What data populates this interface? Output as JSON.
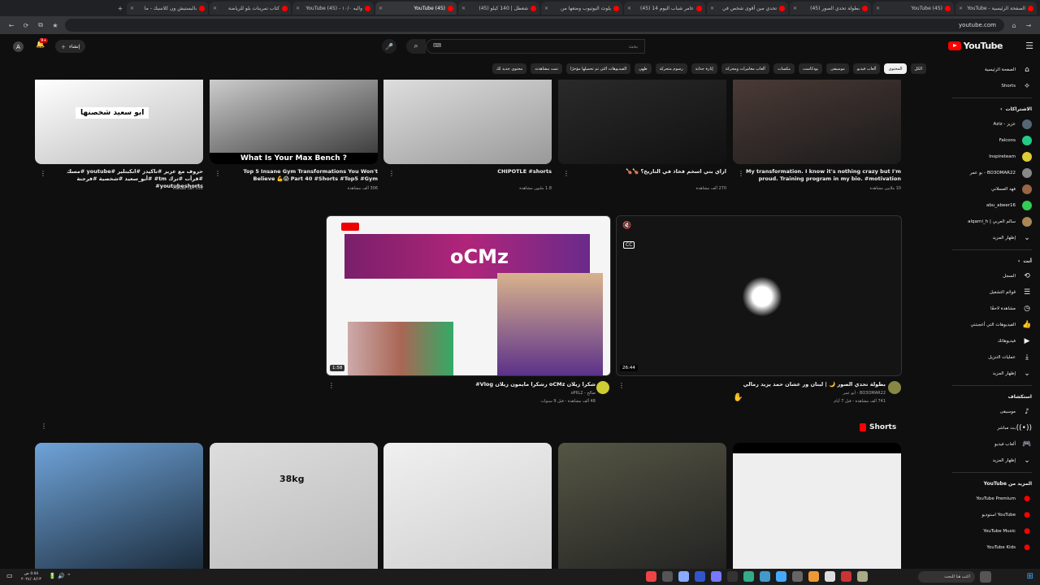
{
  "browser": {
    "tabs": [
      {
        "label": "الصفحة الرئيسية - YouTube",
        "active": false
      },
      {
        "label": "YouTube (45)",
        "active": false
      },
      {
        "label": "بطولة تحدي الصور (45)",
        "active": false
      },
      {
        "label": "تحدي مين أقوى شخص في",
        "active": false
      },
      {
        "label": "عامر شباب اليوم 14 (45)",
        "active": false
      },
      {
        "label": "يلوث اليوتيوب وضعها من",
        "active": false
      },
      {
        "label": "شعطل | 140 كيلو (45)",
        "active": false
      },
      {
        "label": "YouTube (45)",
        "active": true
      },
      {
        "label": "واليه ١٠/٠ - YouTube (45)",
        "active": false
      },
      {
        "label": "كتاب تمرينات بلو للرياضة",
        "active": false
      },
      {
        "label": "بالبستيش ون كلاسيك - ما",
        "active": false
      }
    ],
    "url": "youtube.com"
  },
  "header": {
    "logo": "YouTube",
    "logo_region": "SA",
    "search_placeholder": "بحث",
    "create_label": "إنشاء",
    "notif_count": "9+",
    "avatar_letter": "A"
  },
  "chips": [
    {
      "label": "الكل",
      "on": false
    },
    {
      "label": "المحتوى",
      "on": true
    },
    {
      "label": "ألعاب فيديو",
      "on": false
    },
    {
      "label": "موسيقى",
      "on": false
    },
    {
      "label": "بودكاست",
      "on": false
    },
    {
      "label": "مكسات",
      "on": false
    },
    {
      "label": "ألعاب مغامرات ومحركة",
      "on": false
    },
    {
      "label": "إثارة جذابة",
      "on": false
    },
    {
      "label": "رسوم متحركة",
      "on": false
    },
    {
      "label": "طهي",
      "on": false
    },
    {
      "label": "الفيديوهات التي تم تحميلها مؤخرًا",
      "on": false
    },
    {
      "label": "تمت مشاهدته",
      "on": false
    },
    {
      "label": "محتوى جديد لك",
      "on": false
    }
  ],
  "sidebar": {
    "main": [
      {
        "icon": "home-icon",
        "glyph": "⌂",
        "label": "الصفحة الرئيسية"
      },
      {
        "icon": "shorts-icon",
        "glyph": "⟡",
        "label": "Shorts"
      }
    ],
    "subs_title": "الاشتراكات",
    "subs": [
      {
        "label": "عزيز - Aziz",
        "color": "#567"
      },
      {
        "label": "Falcons",
        "color": "#2c8"
      },
      {
        "label": "Inspireteam",
        "color": "#dc3"
      },
      {
        "label": "BO3OMAR22 - بو عمر",
        "color": "#888"
      },
      {
        "label": "فهد العسلاني",
        "color": "#964"
      },
      {
        "label": "abu_abeer16",
        "color": "#3c5"
      },
      {
        "label": "سالم العربي | alqarni_h",
        "color": "#a85"
      }
    ],
    "subs_more": "إظهار المزيد",
    "you_title": "أنت",
    "you": [
      {
        "glyph": "⟲",
        "label": "السجل"
      },
      {
        "glyph": "☰",
        "label": "قوائم التشغيل"
      },
      {
        "glyph": "◷",
        "label": "مشاهدة لاحقًا"
      },
      {
        "glyph": "👍",
        "label": "الفيديوهات التي أعجبتني"
      },
      {
        "glyph": "▶",
        "label": "فيديوهاتك"
      },
      {
        "glyph": "⤓",
        "label": "عمليات التنزيل"
      }
    ],
    "you_more": "إظهار المزيد",
    "explore_title": "استكشاف",
    "explore": [
      {
        "glyph": "♪",
        "label": "موسيقى"
      },
      {
        "glyph": "((•))",
        "label": "بث مباشر"
      },
      {
        "glyph": "🎮",
        "label": "ألعاب فيديو"
      }
    ],
    "explore_more": "إظهار المزيد",
    "more_title": "المزيد من YouTube",
    "more": [
      {
        "label": "YouTube Premium"
      },
      {
        "label": "YouTube استوديو"
      },
      {
        "label": "YouTube Music"
      },
      {
        "label": "YouTube Kids"
      }
    ]
  },
  "top_shorts": [
    {
      "title": "My transformation. I know it's nothing crazy but I'm proud. Training program in my bio. #motivation",
      "meta": "10 ملايين مشاهدة",
      "thumb_text": ""
    },
    {
      "title": "ازاي بتي اسخم فخاذ في التاريخ؟ 🍗🍗",
      "meta": "270 ألف مشاهدة",
      "thumb_text": ""
    },
    {
      "title": "CHIPOTLE #shorts",
      "meta": "1.8 مليون مشاهدة",
      "thumb_text": ""
    },
    {
      "title": "Top 5 Insane Gym Transformations You Won't Believe 💪😱 Part 40 #Shorts #Top5 #Gym",
      "meta": "306 ألف مشاهدة",
      "thumb_text": "What Is Your Max Bench ?"
    },
    {
      "title": "حروف مع عزيز #تاكيدز #انكبتلير #youtube #مسك #قرأت #ترك tm# #أبو_سعيد #شخصية #فرجنة youtubeshorts#",
      "meta": "532 ألف مشاهدة",
      "thumb_text": "ابو سعيد شخصنها"
    }
  ],
  "videos": [
    {
      "title": "بطولة تحدي الصور 🌙 | لبنان ور عشان حمد يزيد رمالي",
      "channel": "BO3OMAR22 - أبو عمر",
      "meta": "741 ألف مشاهدة - قبل 7 أيام",
      "duration": "26:44",
      "brand": "oCMz"
    },
    {
      "title": "شكرا زيلان oCMz رشكرا مايمون زيلان Vlog#",
      "channel": "صالح - oPIlL2",
      "meta": "48 ألف مشاهدة - قبل 9 سنوات",
      "duration": "1:58",
      "brand": "oCMz"
    }
  ],
  "shorts_label": "Shorts",
  "bottom_shorts": [
    {
      "thumb_text": ""
    },
    {
      "thumb_text": "38kg"
    },
    {
      "thumb_text": ""
    },
    {
      "thumb_text": ""
    },
    {
      "thumb_text": ""
    }
  ],
  "taskbar": {
    "search_placeholder": "اكتب هنا للبحث",
    "time": "٥:٥٥ ص",
    "date": "٢٠٢٤/٠٨/١٣"
  }
}
